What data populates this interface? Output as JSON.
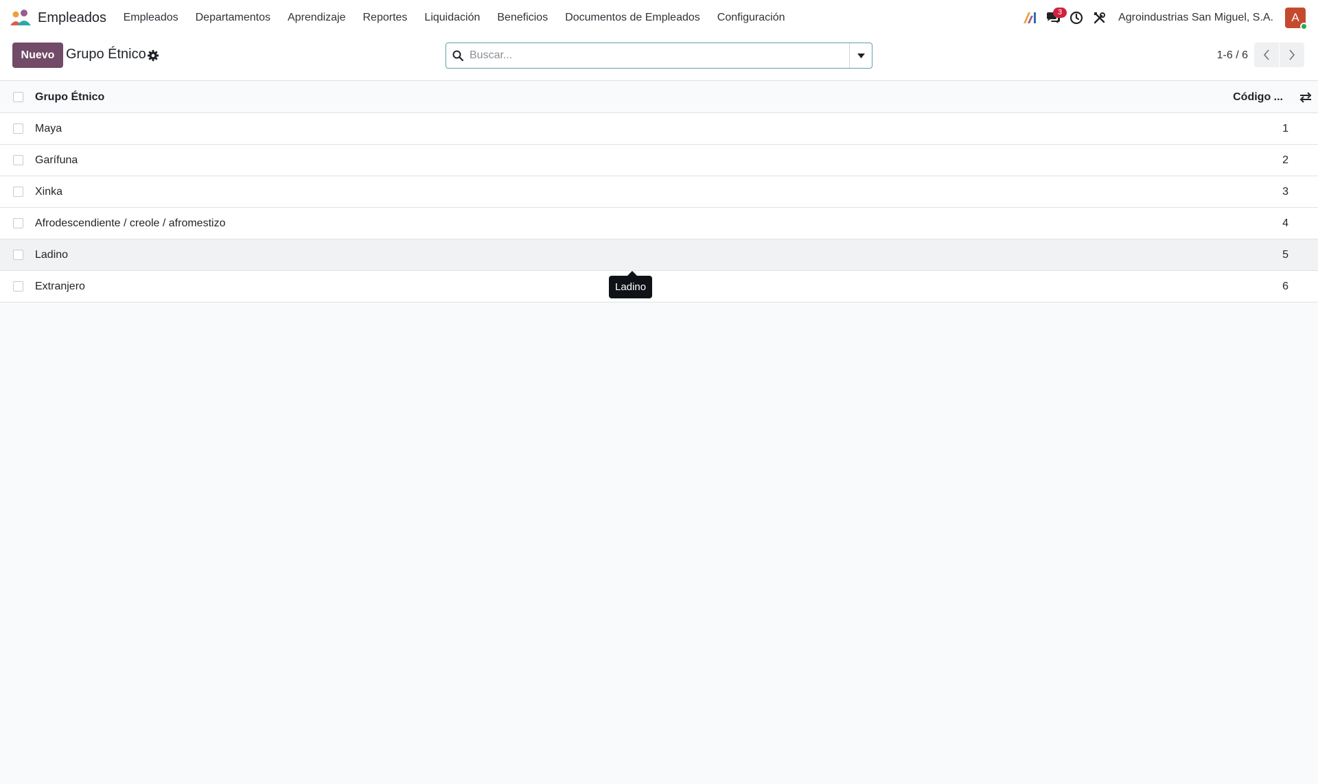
{
  "app": {
    "name": "Empleados"
  },
  "menu": [
    "Empleados",
    "Departamentos",
    "Aprendizaje",
    "Reportes",
    "Liquidación",
    "Beneficios",
    "Documentos de Empleados",
    "Configuración"
  ],
  "systray": {
    "messages_count": "3",
    "company": "Agroindustrias San Miguel, S.A.",
    "avatar_letter": "A",
    "icons": [
      "ai-icon",
      "chat-icon",
      "clock-icon",
      "tools-icon"
    ]
  },
  "control": {
    "new_label": "Nuevo",
    "title": "Grupo Étnico",
    "search_placeholder": "Buscar...",
    "pager": "1-6 / 6"
  },
  "table": {
    "columns": [
      "Grupo Étnico",
      "Código ..."
    ],
    "rows": [
      {
        "name": "Maya",
        "code": "1"
      },
      {
        "name": "Garífuna",
        "code": "2"
      },
      {
        "name": "Xinka",
        "code": "3"
      },
      {
        "name": "Afrodescendiente / creole / afromestizo",
        "code": "4"
      },
      {
        "name": "Ladino",
        "code": "5"
      },
      {
        "name": "Extranjero",
        "code": "6"
      }
    ]
  },
  "tooltip": {
    "text": "Ladino"
  },
  "colors": {
    "primary": "#714b67",
    "badge": "#d1213e",
    "avatar": "#c44a2d"
  }
}
